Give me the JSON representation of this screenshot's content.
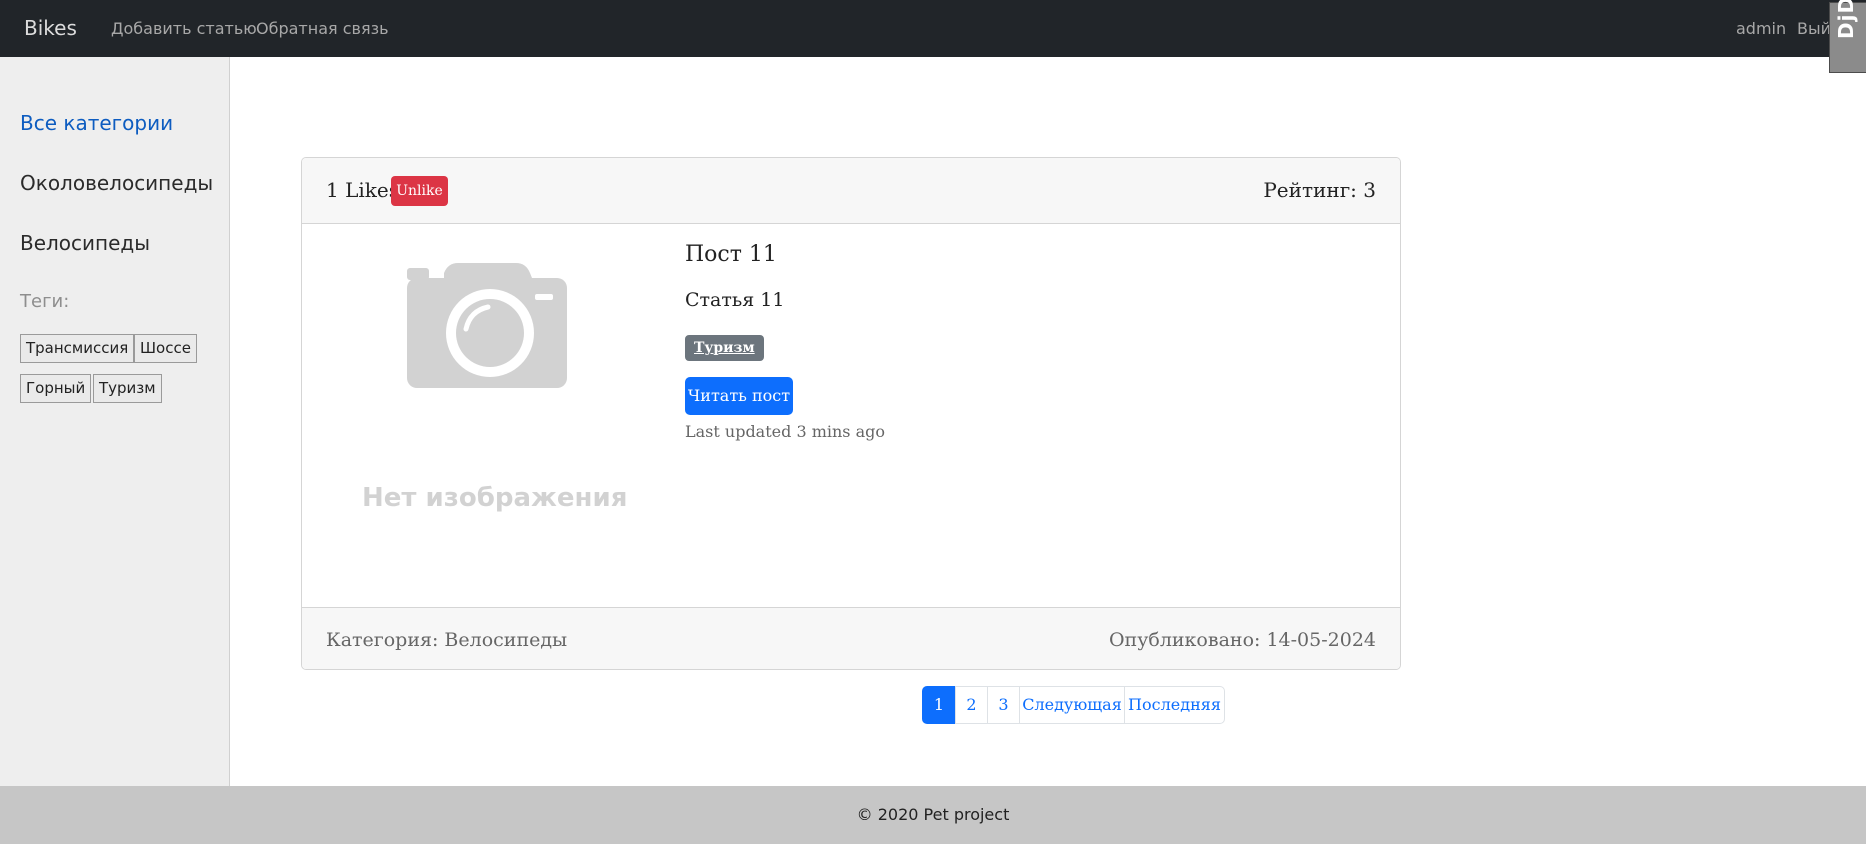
{
  "navbar": {
    "brand": "Bikes",
    "links": [
      "Добавить статью",
      "Обратная связь"
    ],
    "user": "admin",
    "logout": "Выйти"
  },
  "debug_toolbar": {
    "label": "DjDT"
  },
  "sidebar": {
    "categories": [
      "Все категории",
      "Околовелосипеды",
      "Велосипеды"
    ],
    "active_category": "Все категории",
    "tags_title": "Теги:",
    "tags": [
      "Трансмиссия",
      "Шоссе",
      "Горный",
      "Туризм"
    ]
  },
  "post": {
    "likes": "1 Likes",
    "unlike_label": "Unlike",
    "rating": "Рейтинг: 3",
    "image_placeholder_text": "Нет изображения",
    "title": "Пост 11",
    "subtitle": "Статья 11",
    "tag_badge": "Туризм",
    "read_button": "Читать пост",
    "updated": "Last updated 3 mins ago",
    "category": "Категория: Велосипеды",
    "published": "Опубликовано: 14-05-2024"
  },
  "pagination": {
    "pages": [
      "1",
      "2",
      "3"
    ],
    "current_page": "1",
    "next_label": "Следующая",
    "last_label": "Последняя"
  },
  "footer": {
    "text": "© 2020 Pet project"
  },
  "colors": {
    "navbar_bg": "#212529",
    "sidebar_bg": "#eeeeee",
    "primary": "#0d6efd",
    "danger": "#dc3545",
    "secondary": "#6c757d",
    "footer_bg": "#c6c6c6"
  }
}
